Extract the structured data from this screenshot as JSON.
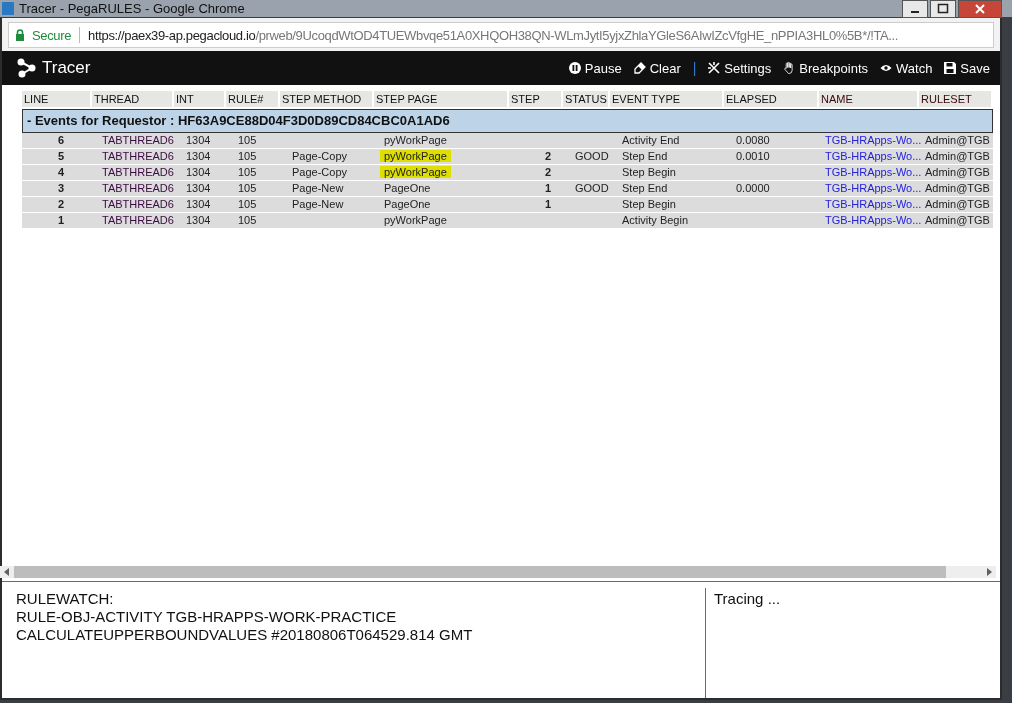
{
  "browser": {
    "title": "Tracer - PegaRULES - Google Chrome",
    "secure_label": "Secure",
    "url_host": "https://paex39-ap.pegacloud.io",
    "url_path": "/prweb/9UcoqdWtOD4TUEWbvqe51A0XHQOH38QN-WLmJytI5yjxZhlaYGleS6AIwIZcVfgHE_nPPIA3HL0%5B*/!TA..."
  },
  "toolbar": {
    "title": "Tracer",
    "buttons": [
      {
        "kind": "pause",
        "label": "Pause"
      },
      {
        "kind": "clear",
        "label": "Clear"
      },
      {
        "kind": "divider",
        "label": "|"
      },
      {
        "kind": "settings",
        "label": "Settings"
      },
      {
        "kind": "breakpoints",
        "label": "Breakpoints"
      },
      {
        "kind": "watch",
        "label": "Watch"
      },
      {
        "kind": "save",
        "label": "Save"
      }
    ]
  },
  "table": {
    "columns": [
      "LINE",
      "THREAD",
      "INT",
      "RULE#",
      "STEP METHOD",
      "STEP PAGE",
      "STEP",
      "STATUS",
      "EVENT TYPE",
      "ELAPSED",
      "NAME",
      "RULESET"
    ],
    "group": "- Events for Requestor : HF63A9CE88D04F3D0D89CD84CBC0A1AD6",
    "rows": [
      {
        "line": "6",
        "thread": "TABTHREAD6",
        "int": "1304",
        "rule": "105",
        "step_method": "",
        "step_page": "pyWorkPage",
        "highlighted": false,
        "step": "",
        "status": "",
        "event_type": "Activity End",
        "elapsed": "0.0080",
        "name": "TGB-HRApps-Wo...",
        "ruleset": "Admin@TGB"
      },
      {
        "line": "5",
        "thread": "TABTHREAD6",
        "int": "1304",
        "rule": "105",
        "step_method": "Page-Copy",
        "step_page": "pyWorkPage",
        "highlighted": true,
        "step": "2",
        "status": "GOOD",
        "event_type": "Step End",
        "elapsed": "0.0010",
        "name": "TGB-HRApps-Wo...",
        "ruleset": "Admin@TGB"
      },
      {
        "line": "4",
        "thread": "TABTHREAD6",
        "int": "1304",
        "rule": "105",
        "step_method": "Page-Copy",
        "step_page": "pyWorkPage",
        "highlighted": true,
        "step": "2",
        "status": "",
        "event_type": "Step Begin",
        "elapsed": "",
        "name": "TGB-HRApps-Wo...",
        "ruleset": "Admin@TGB"
      },
      {
        "line": "3",
        "thread": "TABTHREAD6",
        "int": "1304",
        "rule": "105",
        "step_method": "Page-New",
        "step_page": "PageOne",
        "highlighted": false,
        "step": "1",
        "status": "GOOD",
        "event_type": "Step End",
        "elapsed": "0.0000",
        "name": "TGB-HRApps-Wo...",
        "ruleset": "Admin@TGB"
      },
      {
        "line": "2",
        "thread": "TABTHREAD6",
        "int": "1304",
        "rule": "105",
        "step_method": "Page-New",
        "step_page": "PageOne",
        "highlighted": false,
        "step": "1",
        "status": "",
        "event_type": "Step Begin",
        "elapsed": "",
        "name": "TGB-HRApps-Wo...",
        "ruleset": "Admin@TGB"
      },
      {
        "line": "1",
        "thread": "TABTHREAD6",
        "int": "1304",
        "rule": "105",
        "step_method": "",
        "step_page": "pyWorkPage",
        "highlighted": false,
        "step": "",
        "status": "",
        "event_type": "Activity Begin",
        "elapsed": "",
        "name": "TGB-HRApps-Wo...",
        "ruleset": "Admin@TGB"
      }
    ]
  },
  "footer": {
    "rulewatch": [
      "RULEWATCH:",
      "RULE-OBJ-ACTIVITY TGB-HRAPPS-WORK-PRACTICE",
      "CALCULATEUPPERBOUNDVALUES #20180806T064529.814 GMT"
    ],
    "status": "Tracing ..."
  }
}
